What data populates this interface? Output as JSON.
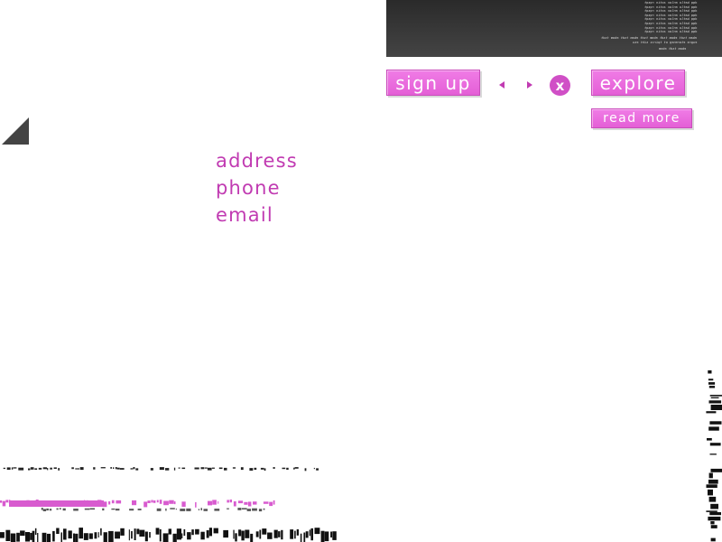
{
  "code_panel": {
    "lines": [
      "dqq  batlo  enlav  zotin  rqsqt",
      "dqq  batlo  enlav  zotin  rqsqt",
      "dqq  batlo  enlav  zotin  rqsqt",
      "dqq  batlo  enlav  zotin  rqsqt",
      "dqq  batlo  enlav  zotin  rqsqt",
      "dqq  batlo  enlav  zotin  rqsqt",
      "dqq  batlo  enlav  zotin  rqsqt",
      "dqq  batlo  enlav  zotin  rqsqt",
      "ebam tsdt  ebam tsdt  ebam tsdt  ebam tsdt  ebam tsdt",
      "eugra etareneg ot tpircs siht esu",
      "ebam tsdt ebam"
    ]
  },
  "buttons": {
    "signup": "sign up",
    "explore": "explore",
    "read_more": "read more",
    "close": "x"
  },
  "contact_links": {
    "address": "address",
    "phone": "phone",
    "email": "email"
  },
  "colors": {
    "accent_pink": "#e45fd6",
    "link_magenta": "#c13bb2",
    "panel_dark": "#333333",
    "triangle_gray": "#444444"
  }
}
